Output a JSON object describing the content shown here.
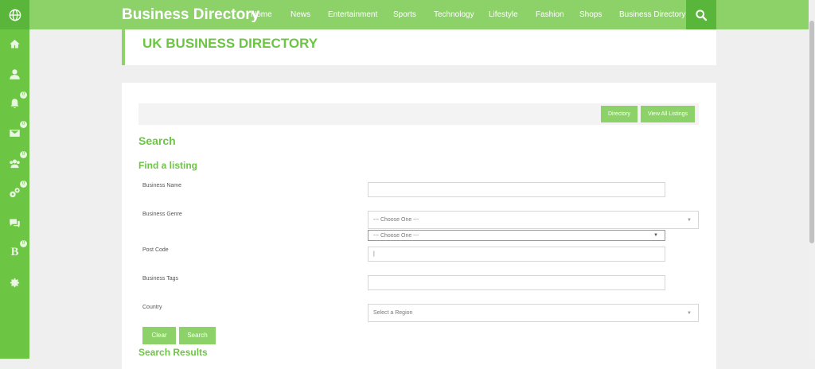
{
  "topbar": {
    "brand": "Business Directory",
    "nav": [
      "Home",
      "News",
      "Entertainment",
      "Sports",
      "Technology",
      "Lifestyle",
      "Fashion",
      "Shops",
      "Business Directory"
    ]
  },
  "sidebar": {
    "badges": [
      "0",
      "0",
      "0",
      "0",
      "0"
    ]
  },
  "page": {
    "title": "UK BUSINESS DIRECTORY"
  },
  "toolbar": {
    "directory": "Directory",
    "view_all": "View All Listings"
  },
  "search": {
    "heading": "Search",
    "subheading": "Find a listing",
    "fields": {
      "business_name": "Business Name",
      "business_genre": "Business Genre",
      "genre_select": "--- Choose One ---",
      "genre_select_2": "--- Choose One ---",
      "post_code": "Post Code",
      "post_code_value": "|",
      "business_tags": "Business Tags",
      "country": "Country",
      "region_select": "Select a Region"
    },
    "clear": "Clear",
    "submit": "Search",
    "results_heading": "Search Results"
  },
  "colors": {
    "accent": "#6cc644",
    "nav_bg": "#8dd268",
    "sidebar_bg": "#6cc644"
  }
}
